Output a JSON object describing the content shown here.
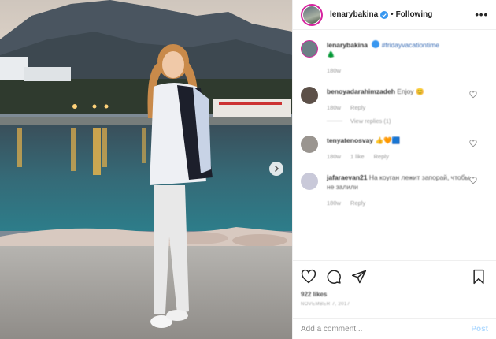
{
  "header": {
    "username": "lenarybakina",
    "separator": "•",
    "follow_label": "Following",
    "more_label": "•••"
  },
  "comments": [
    {
      "username": "lenarybakina",
      "text": "#fridayvacationtime",
      "emoji": "🌲",
      "time": "180w",
      "avatar_color": "#6d7f86"
    },
    {
      "username": "benoyadarahimzadeh",
      "text": "Enjoy",
      "emoji": "😊",
      "time": "180w",
      "reply_label": "Reply",
      "view_replies": "View replies (1)",
      "avatar_color": "#5c5048"
    },
    {
      "username": "tenyatenosvay",
      "text": "",
      "emoji": "👍🧡🟦",
      "time": "180w",
      "likes_label": "1 like",
      "reply_label": "Reply",
      "avatar_color": "#9a9590"
    },
    {
      "username": "jafaraevan21",
      "text": "На коуган лежит запорай, чтобы не залили",
      "emoji": "",
      "time": "180w",
      "reply_label": "Reply",
      "avatar_color": "#c9c9d9"
    }
  ],
  "actions": {
    "likes": "922 likes",
    "date": "NOVEMBER 7, 2017"
  },
  "add_comment": {
    "placeholder": "Add a comment...",
    "post_label": "Post"
  },
  "colors": {
    "link": "#3a6db5",
    "post_disabled": "#b3dbff",
    "story_ring": "#d6249f",
    "verified": "#3897f0"
  }
}
